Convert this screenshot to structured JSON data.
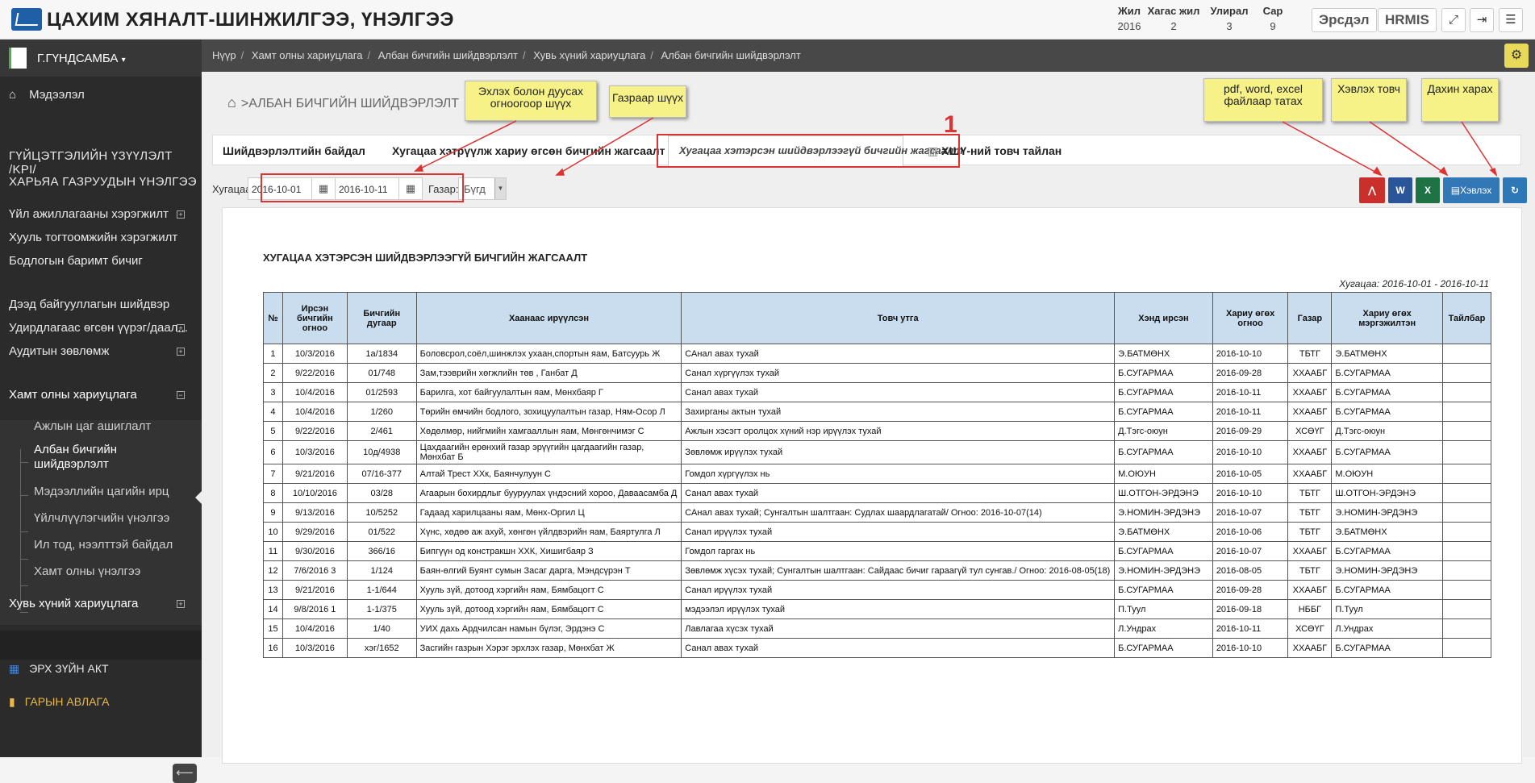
{
  "header": {
    "title": "ЦАХИМ ХЯНАЛТ-ШИНЖИЛГЭЭ, ҮНЭЛГЭЭ",
    "periods": [
      {
        "label": "Жил",
        "value": "2016"
      },
      {
        "label": "Хагас жил",
        "value": "2"
      },
      {
        "label": "Улирал",
        "value": "3"
      },
      {
        "label": "Сар",
        "value": "9"
      }
    ],
    "ersdel_label": "Эрсдэл",
    "hrmis_label": "HRMIS"
  },
  "sidebar": {
    "user": "Г.ГҮНДСАМБА",
    "info": "Мэдээлэл",
    "kpi": "ГҮЙЦЭТГЭЛИЙН ҮЗҮҮЛЭЛТ /KPI/",
    "subord": "ХАРЬЯА ГАЗРУУДЫН ҮНЭЛГЭЭ",
    "items1": [
      "Үйл ажиллагааны хэрэгжилт",
      "Хууль тогтоомжийн хэрэгжилт",
      "Бодлогын баримт бичиг"
    ],
    "items2": [
      "Дээд байгууллагын шийдвэр",
      "Удирдлагаас өгсөн үүрэг/даал...",
      "Аудитын зөвлөмж"
    ],
    "hamt_title": "Хамт олны хариуцлага",
    "hamt_items": [
      "Ажлын цаг ашиглалт",
      "Албан бичгийн шийдвэрлэлт",
      "Мэдээллийн цагийн ирц",
      "Үйлчлүүлэгчийн үнэлгээ",
      "Ил тод, нээлттэй байдал",
      "Хамт олны үнэлгээ"
    ],
    "hkh": "Хувь хүний хариуцлага",
    "erkh": "ЭРХ ЗҮЙН АКТ",
    "gar": "ГАРЫН АВЛАГА"
  },
  "breadcrumb": [
    "Нүүр",
    "Хамт олны хариуцлага",
    "Албан бичгийн шийдвэрлэлт",
    "Хувь хүний хариуцлага",
    "Албан бичгийн шийдвэрлэлт"
  ],
  "page_title": ">АЛБАН БИЧГИЙН ШИЙДВЭРЛЭЛТ",
  "tabs": [
    "Шийдвэрлэлтийн байдал",
    "Хугацаа хэтрүүлж хариу өгсөн бичгийн жагсаалт",
    "Хугацаа хэтэрсэн шийдвэрлээгүй бичгийн жагсаалт",
    "ХШҮ-ний товч тайлан"
  ],
  "filters": {
    "period_label": "Хугацаа:",
    "date_from": "2016-10-01",
    "date_to": "2016-10-11",
    "gazar_label": "Газар:",
    "gazar_value": "Бүгд",
    "print_label": "Хэвлэх"
  },
  "colors": {
    "pdf": "#c9302c",
    "word": "#2a5699",
    "excel": "#1f7244",
    "print": "#3277b6",
    "refresh": "#2f78b7"
  },
  "report": {
    "title": "ХУГАЦАА ХЭТЭРСЭН ШИЙДВЭРЛЭЭГҮЙ БИЧГИЙН ЖАГСААЛТ",
    "range": "Хугацаа: 2016-10-01 - 2016-10-11",
    "columns": [
      "№",
      "Ирсэн бичгийн огноо",
      "Бичгийн дугаар",
      "Хаанаас ирүүлсэн",
      "Товч утга",
      "Хэнд ирсэн",
      "Хариу өгөх огноо",
      "Газар",
      "Хариу өгөх мэргэжилтэн",
      "Тайлбар"
    ],
    "rows": [
      [
        "1",
        "10/3/2016",
        "1а/1834",
        "Боловсрол,соёл,шинжлэх ухаан,спортын яам, Батсуурь Ж",
        "САнал авах тухай",
        "Э.БАТМӨНХ",
        "2016-10-10",
        "ТБТГ",
        "Э.БАТМӨНХ",
        ""
      ],
      [
        "2",
        "9/22/2016",
        "01/748",
        "Зам,тээврийн хөгжлийн төв , Ганбат Д",
        "Санал хүргүүлэх тухай",
        "Б.СУГАРМАА",
        "2016-09-28",
        "ХХААБГ",
        "Б.СУГАРМАА",
        ""
      ],
      [
        "3",
        "10/4/2016",
        "01/2593",
        "Барилга, хот байгуулалтын яам, Мөнхбаяр Г",
        "Санал авах тухай",
        "Б.СУГАРМАА",
        "2016-10-11",
        "ХХААБГ",
        "Б.СУГАРМАА",
        ""
      ],
      [
        "4",
        "10/4/2016",
        "1/260",
        "Төрийн өмчийн бодлого, зохицуулалтын газар, Ням-Осор Л",
        "Захирганы актын тухай",
        "Б.СУГАРМАА",
        "2016-10-11",
        "ХХААБГ",
        "Б.СУГАРМАА",
        ""
      ],
      [
        "5",
        "9/22/2016",
        "2/461",
        "Хөдөлмөр, нийгмийн хамгааллын яам, Мөнгөнчимэг С",
        "Ажлын хэсэгт оролцох хүний нэр ирүүлэх тухай",
        "Д.Тэгс-оюун",
        "2016-09-29",
        "ХСӨҮГ",
        "Д.Тэгс-оюун",
        ""
      ],
      [
        "6",
        "10/3/2016",
        "10д/4938",
        "Цахдаагийн ерөнхий газар эрүүгийн цагдаагийн газар, Мөнхбат Б",
        "Зөвлөмж ирүүлэх тухай",
        "Б.СУГАРМАА",
        "2016-10-10",
        "ХХААБГ",
        "Б.СУГАРМАА",
        ""
      ],
      [
        "7",
        "9/21/2016",
        "07/16-377",
        "Алтай Трест ХХк, Баянчулуун С",
        "Гомдол хүргүүлэх нь",
        "М.ОЮУН",
        "2016-10-05",
        "ХХААБГ",
        "М.ОЮУН",
        ""
      ],
      [
        "8",
        "10/10/2016",
        "03/28",
        "Агаарын бохирдлыг бууруулах үндэсний хороо, Даваасамба Д",
        "Санал авах тухай",
        "Ш.ОТГОН-ЭРДЭНЭ",
        "2016-10-10",
        "ТБТГ",
        "Ш.ОТГОН-ЭРДЭНЭ",
        ""
      ],
      [
        "9",
        "9/13/2016",
        "10/5252",
        "Гадаад харилцааны яам, Мөнх-Оргил Ц",
        "САнал авах тухай; Сунгалтын шалтгаан: Судлах шаардлагатай/ Огноо: 2016-10-07(14)",
        "Э.НОМИН-ЭРДЭНЭ",
        "2016-10-07",
        "ТБТГ",
        "Э.НОМИН-ЭРДЭНЭ",
        ""
      ],
      [
        "10",
        "9/29/2016",
        "01/522",
        "Хүнс, хөдөө аж ахуй, хөнгөн үйлдвэрийн яам, Баяртулга Л",
        "Санал ирүүлэх тухай",
        "Э.БАТМӨНХ",
        "2016-10-06",
        "ТБТГ",
        "Э.БАТМӨНХ",
        ""
      ],
      [
        "11",
        "9/30/2016",
        "366/16",
        "Бипгүүн од констракшн ХХК, Хишигбаяр З",
        "Гомдол гаргах нь",
        "Б.СУГАРМАА",
        "2016-10-07",
        "ХХААБГ",
        "Б.СУГАРМАА",
        ""
      ],
      [
        "12",
        "7/6/2016 3",
        "1/124",
        "Баян-өлгий Буянт сумын Засаг дарга, Мэндсүрэн Т",
        "Зөвлөмж хүсэх тухай; Сунгалтын шалтгаан: Сайдаас бичиг гараагүй тул сунгав./ Огноо: 2016-08-05(18)",
        "Э.НОМИН-ЭРДЭНЭ",
        "2016-08-05",
        "ТБТГ",
        "Э.НОМИН-ЭРДЭНЭ",
        ""
      ],
      [
        "13",
        "9/21/2016",
        "1-1/644",
        "Хууль зүй, дотоод хэргийн яам, Бямбацогт С",
        "Санал ирүүлэх тухай",
        "Б.СУГАРМАА",
        "2016-09-28",
        "ХХААБГ",
        "Б.СУГАРМАА",
        ""
      ],
      [
        "14",
        "9/8/2016 1",
        "1-1/375",
        "Хууль зүй, дотоод хэргийн яам, Бямбацогт С",
        "мэдээлэл ирүүлэх тухай",
        "П.Туул",
        "2016-09-18",
        "НББГ",
        "П.Туул",
        ""
      ],
      [
        "15",
        "10/4/2016",
        "1/40",
        "УИХ дахь Ардчилсан намын бүлэг, Эрдэнэ С",
        "Лавлагаа хүсэх тухай",
        "Л.Ундрах",
        "2016-10-11",
        "ХСӨҮГ",
        "Л.Ундрах",
        ""
      ],
      [
        "16",
        "10/3/2016",
        "хэг/1652",
        "Засгийн газрын Хэрэг эрхлэх газар, Мөнхбат Ж",
        "Санал авах тухай",
        "Б.СУГАРМАА",
        "2016-10-10",
        "ХХААБГ",
        "Б.СУГАРМАА",
        ""
      ]
    ]
  },
  "annotations": {
    "date_filter": "Эхлэх болон дуусах огноогоор шүүх",
    "gazar_filter": "Газраар шүүх",
    "export": "pdf, word, excel файлаар татах",
    "print": "Хэвлэх товч",
    "refresh": "Дахин харах",
    "marker": "1"
  }
}
